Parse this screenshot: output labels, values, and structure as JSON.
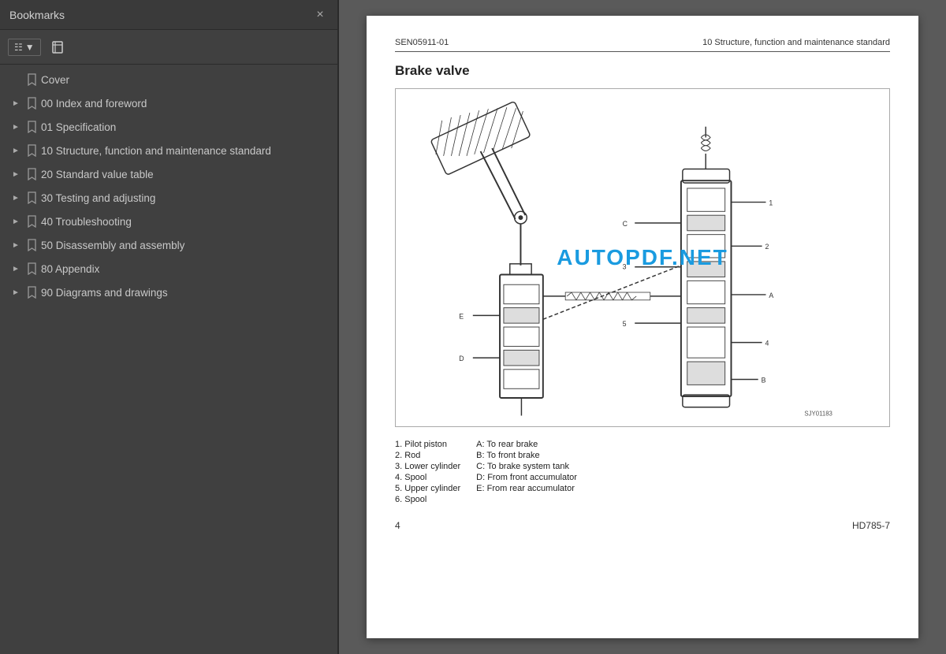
{
  "sidebar": {
    "title": "Bookmarks",
    "close_label": "×",
    "toolbar": {
      "expand_collapse_label": "⊞",
      "bookmark_icon_label": "🔖"
    },
    "items": [
      {
        "id": "cover",
        "label": "Cover",
        "expandable": false,
        "level": 0
      },
      {
        "id": "00-index",
        "label": "00 Index and foreword",
        "expandable": true,
        "level": 0
      },
      {
        "id": "01-spec",
        "label": "01 Specification",
        "expandable": true,
        "level": 0
      },
      {
        "id": "10-structure",
        "label": "10 Structure, function and maintenance standard",
        "expandable": true,
        "level": 0
      },
      {
        "id": "20-standard",
        "label": "20 Standard value table",
        "expandable": true,
        "level": 0
      },
      {
        "id": "30-testing",
        "label": "30 Testing and adjusting",
        "expandable": true,
        "level": 0
      },
      {
        "id": "40-trouble",
        "label": "40 Troubleshooting",
        "expandable": true,
        "level": 0
      },
      {
        "id": "50-disassembly",
        "label": "50 Disassembly and assembly",
        "expandable": true,
        "level": 0
      },
      {
        "id": "80-appendix",
        "label": "80 Appendix",
        "expandable": true,
        "level": 0
      },
      {
        "id": "90-diagrams",
        "label": "90 Diagrams and drawings",
        "expandable": true,
        "level": 0
      }
    ]
  },
  "page": {
    "header_left": "SEN05911-01",
    "header_right": "10 Structure, function and maintenance standard",
    "section_title": "Brake valve",
    "diagram_image_code": "SJY01183",
    "watermark": "AUTOPDF.NET",
    "legend": {
      "left": [
        "1.   Pilot piston",
        "2.   Rod",
        "3.   Lower cylinder",
        "4.   Spool",
        "5.   Upper cylinder",
        "6.   Spool"
      ],
      "right": [
        "A:   To rear brake",
        "B:   To front brake",
        "C:   To brake system tank",
        "D:   From front accumulator",
        "E:   From rear accumulator"
      ]
    },
    "footer_page": "4",
    "footer_model": "HD785-7"
  }
}
